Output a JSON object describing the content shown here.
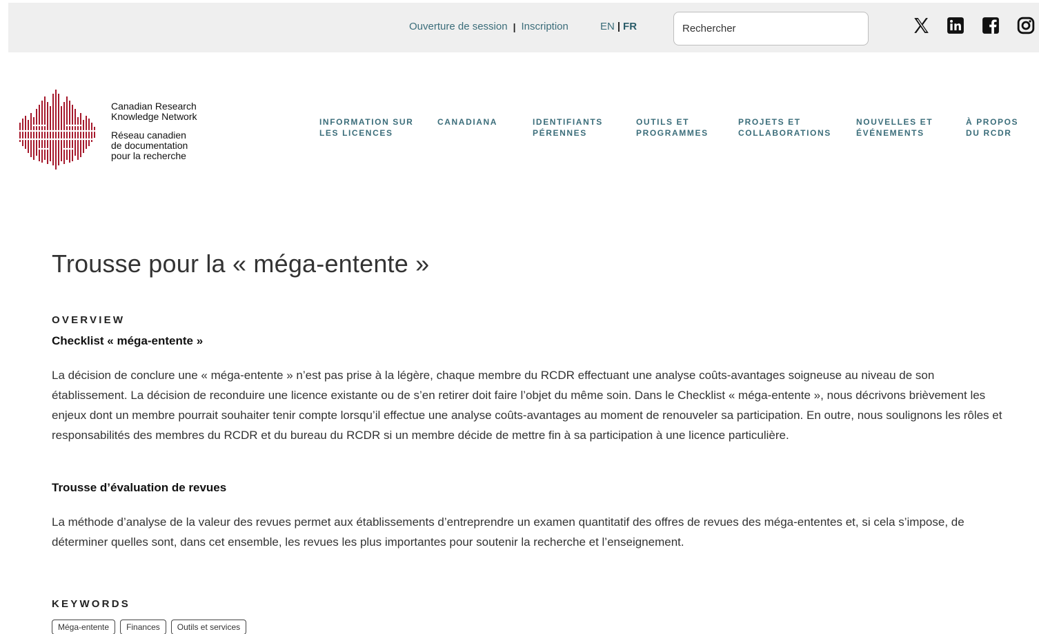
{
  "topbar": {
    "login_label": "Ouverture de session",
    "signup_label": "Inscription",
    "separator": "|",
    "lang_en": "EN",
    "lang_fr": "FR",
    "search_placeholder": "Rechercher",
    "social": [
      "x-icon",
      "linkedin-icon",
      "facebook-icon",
      "instagram-icon"
    ]
  },
  "logo": {
    "name_en": "Canadian Research\nKnowledge Network",
    "name_fr": "Réseau canadien\nde documentation\npour la recherche",
    "brand_color": "#a5182b"
  },
  "nav": {
    "items": [
      {
        "label": "INFORMATION SUR\nLES LICENCES"
      },
      {
        "label": "CANADIANA"
      },
      {
        "label": "IDENTIFIANTS\nPÉRENNES"
      },
      {
        "label": "OUTILS ET\nPROGRAMMES"
      },
      {
        "label": "PROJETS ET\nCOLLABORATIONS"
      },
      {
        "label": "NOUVELLES ET\nÉVÉNEMENTS"
      },
      {
        "label": "À PROPOS\nDU RCDR"
      }
    ]
  },
  "main": {
    "title": "Trousse pour la « méga-entente »",
    "overview_heading": "OVERVIEW",
    "checklist_heading": "Checklist « méga-entente »",
    "checklist_text": "La décision de conclure une « méga-entente » n’est pas prise à la légère, chaque membre du RCDR effectuant une analyse coûts-avantages soigneuse au niveau de son établissement. La décision de reconduire une licence existante ou de s’en retirer doit faire l’objet du même soin. Dans le Checklist « méga-entente », nous décrivons brièvement les enjeux dont un membre pourrait souhaiter tenir compte lorsqu’il effectue une analyse coûts-avantages au moment de renouveler sa participation. En outre, nous soulignons les rôles et responsabilités des membres du RCDR et du bureau du RCDR si un membre décide de mettre fin à sa participation à une licence particulière.",
    "evaluation_heading": "Trousse d’évaluation de revues",
    "evaluation_text": "La méthode d’analyse de la valeur des revues permet aux établissements d’entreprendre un examen quantitatif des offres de revues des méga-ententes et, si cela s’impose, de déterminer quelles sont, dans cet ensemble, les revues les plus importantes pour soutenir la recherche et l’enseignement.",
    "keywords_heading": "KEYWORDS",
    "keywords": [
      "Méga-entente",
      "Finances",
      "Outils et services"
    ]
  },
  "colors": {
    "accent": "#3b6d7a",
    "topbar_bg": "#efefef"
  }
}
